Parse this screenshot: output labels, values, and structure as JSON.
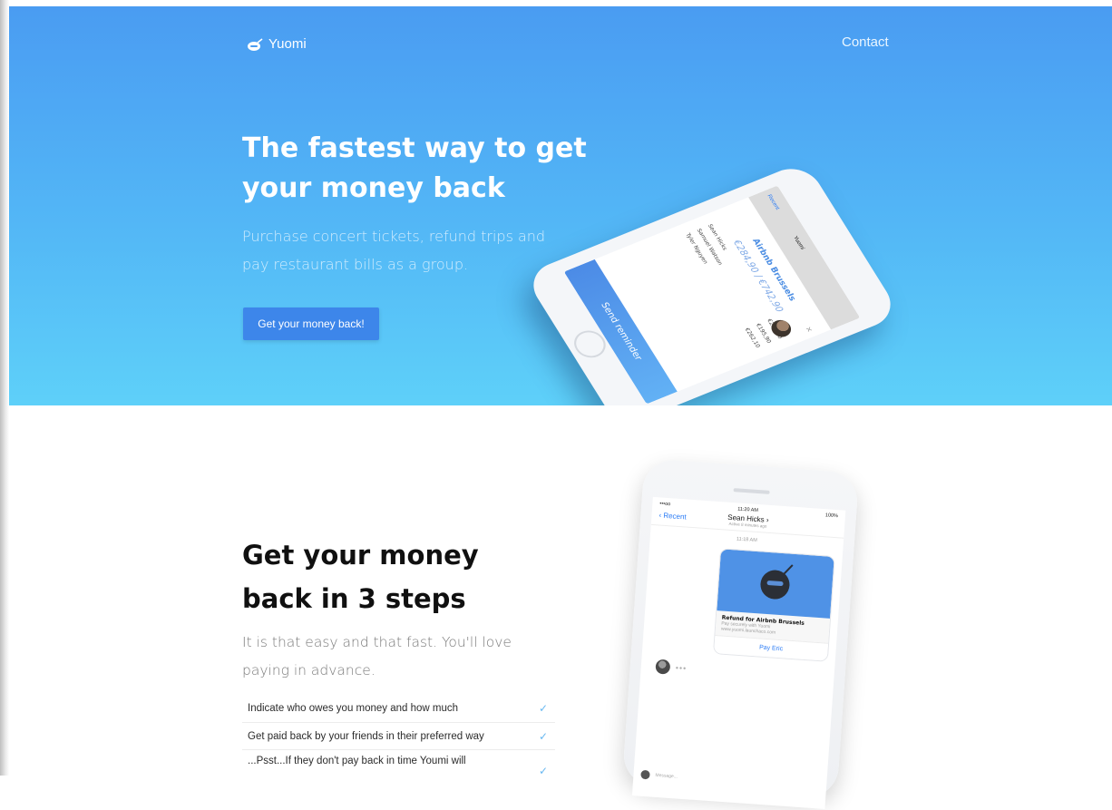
{
  "brand": {
    "name": "Yuomi"
  },
  "nav": {
    "contact": "Contact"
  },
  "hero": {
    "title": "The fastest way to get your money back",
    "subtitle": "Purchase concert tickets, refund trips and pay restaurant bills as a group.",
    "cta": "Get your money back!"
  },
  "hero_phone": {
    "back": "Recent",
    "app_name": "Yuomi",
    "event_title": "Airbnb Brussels",
    "amount": "€284,90 / €742,90",
    "people": [
      {
        "name": "Sean Hicks",
        "amount": "€284,90"
      },
      {
        "name": "Samuel Watson",
        "amount": "€195,90"
      },
      {
        "name": "Tyler Nguyen",
        "amount": "€262,10"
      }
    ],
    "close": "×",
    "button": "Send reminder"
  },
  "steps": {
    "title": "Get your money back in 3 steps",
    "subtitle": "It is that easy and that fast. You'll love paying in advance.",
    "items": [
      "Indicate who owes you money and how much",
      "Get paid back by your friends in their preferred way",
      "...Psst...If they don't pay back in time Youmi will"
    ],
    "check": "✓"
  },
  "chat_phone": {
    "carrier": "•••oo",
    "time": "11:20 AM",
    "battery": "100%",
    "back": "Recent",
    "contact": "Sean Hicks ›",
    "contact_status": "Active 8 minutes ago",
    "message_time": "11:18 AM",
    "card_title": "Refund for Airbnb Brussels",
    "card_sub_1": "Pay securely with Yuomi",
    "card_sub_2": "www.yuomi.launchaco.com",
    "card_action": "Pay Eric",
    "typing": "•••",
    "compose": "Message..."
  },
  "colors": {
    "hero_top": "#4a9cf2",
    "hero_bottom": "#5ed0f9",
    "accent": "#3d86ea",
    "check": "#68b8f1"
  }
}
